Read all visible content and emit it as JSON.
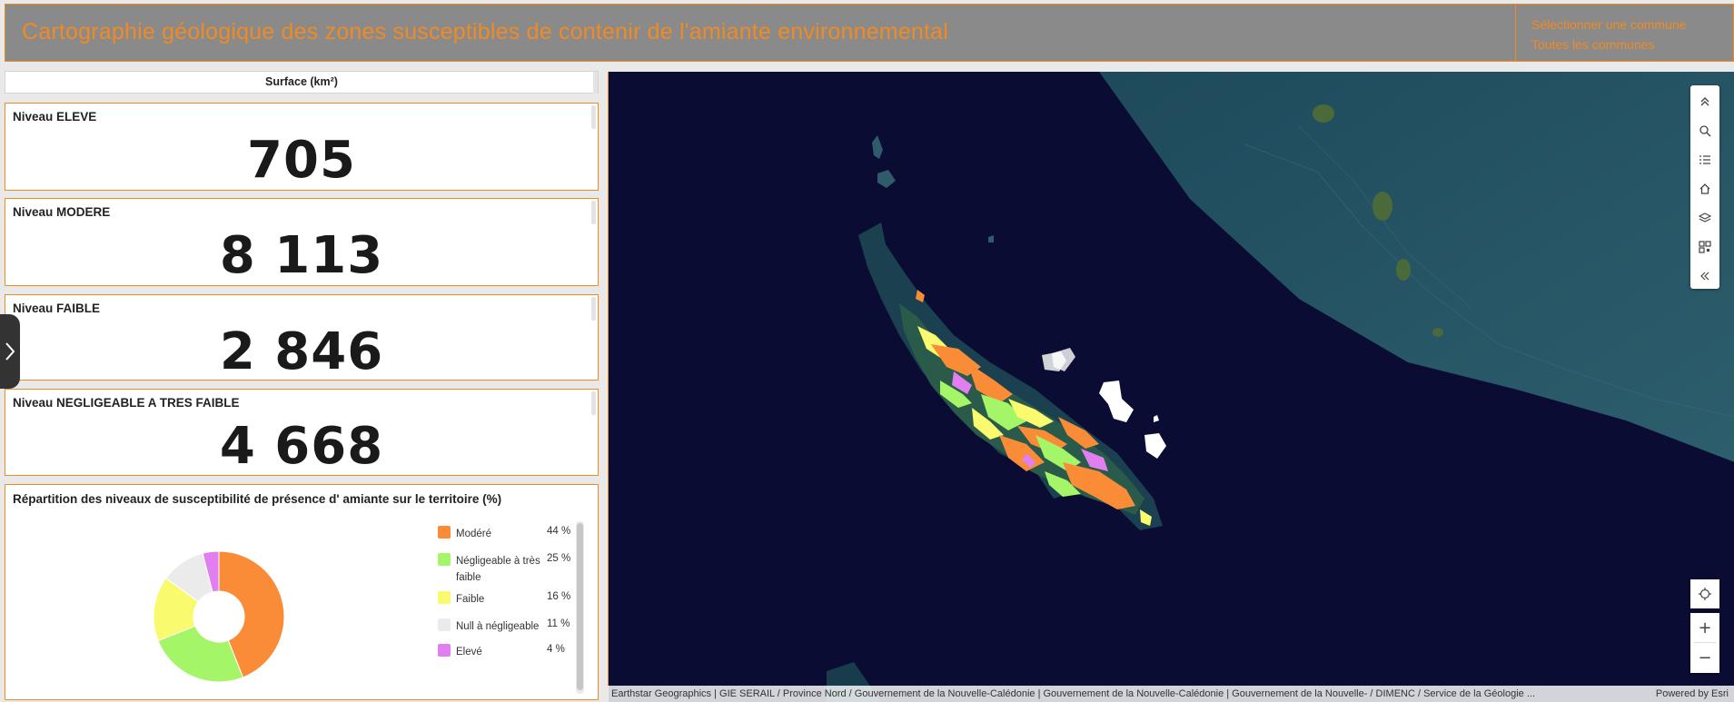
{
  "header": {
    "title": "Cartographie géologique des zones susceptibles de contenir de l'amiante environnemental",
    "select_label": "Sélectionner une commune",
    "all_label": "Toutes les communes"
  },
  "surface": {
    "header": "Surface  (km²)"
  },
  "stats": [
    {
      "label": "Niveau ELEVE",
      "value": "705"
    },
    {
      "label": "Niveau MODERE",
      "value": "8 113"
    },
    {
      "label": "Niveau FAIBLE",
      "value": "2 846"
    },
    {
      "label": "Niveau NEGLIGEABLE A TRES FAIBLE",
      "value": "4 668"
    }
  ],
  "chart_data": {
    "type": "pie",
    "title": "Répartition des niveaux de susceptibilité de présence d' amiante sur le territoire (%)",
    "categories": [
      "Modéré",
      "Négligeable à très faible",
      "Faible",
      "Null à négligeable",
      "Elevé"
    ],
    "values": [
      44,
      25,
      16,
      11,
      4
    ],
    "labels": [
      "44 %",
      "25 %",
      "16 %",
      "11 %",
      "4 %"
    ],
    "colors": [
      "#fb8c37",
      "#a4f567",
      "#fafa6e",
      "#ebebeb",
      "#e27ff0"
    ],
    "donut": true,
    "legend": "right"
  },
  "colors": {
    "accent": "#f08a24",
    "header_bg": "#8a8a8a",
    "map_bg": "#0b0c33"
  },
  "map": {
    "attribution": "Earthstar Geographics | GIE SERAIL / Province Nord / Gouvernement de la Nouvelle-Calédonie | Gouvernement de la Nouvelle-Calédonie | Gouvernement de la Nouvelle- / DIMENC / Service de la Géologie ...",
    "powered_by": "Powered by Esri",
    "tools": [
      "chevron-up-icon",
      "search-icon",
      "list-icon",
      "home-icon",
      "layers-icon",
      "qr-icon",
      "collapse-icon"
    ],
    "zoom_in": "+",
    "zoom_out": "−"
  }
}
